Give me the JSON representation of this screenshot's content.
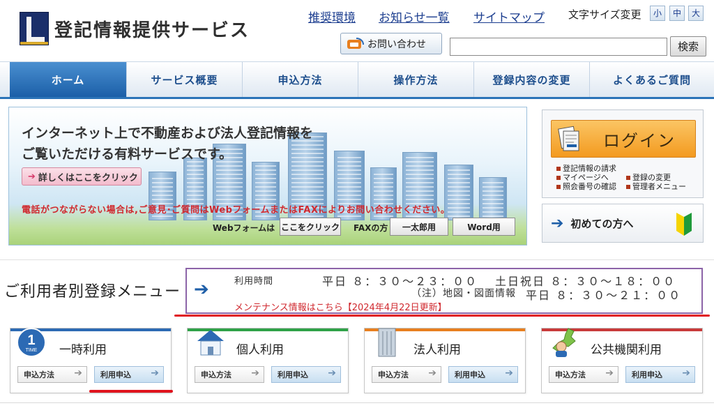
{
  "header": {
    "site_title": "登記情報提供サービス",
    "links": {
      "recommend": "推奨環境",
      "news": "お知らせ一覧",
      "sitemap": "サイトマップ"
    },
    "fontsize_label": "文字サイズ変更",
    "fontsize_options": [
      "小",
      "中",
      "大"
    ],
    "contact_label": "お問い合わせ",
    "search_placeholder": "",
    "search_button": "検索"
  },
  "nav": {
    "items": [
      {
        "label": "ホーム",
        "active": true
      },
      {
        "label": "サービス概要"
      },
      {
        "label": "申込方法"
      },
      {
        "label": "操作方法"
      },
      {
        "label": "登録内容の変更"
      },
      {
        "label": "よくあるご質問"
      }
    ]
  },
  "banner": {
    "title_line1": "インターネット上で不動産および法人登記情報を",
    "title_line2": "ご覧いただける有料サービスです。",
    "detail_button": "詳しくはここをクリック",
    "notice": "電話がつながらない場合は,ご意見･ご質問はWebフォームまたはFAXによりお問い合わせください。",
    "web_label": "Webフォームは",
    "web_button": "ここをクリック",
    "fax_label": "FAXの方",
    "ichitaro_button": "一太郎用",
    "word_button": "Word用"
  },
  "login": {
    "label": "ログイン",
    "sub_items": [
      "登記情報の請求",
      "マイページへ",
      "照会番号の確認",
      "登録の変更",
      "管理者メニュー"
    ],
    "first_time": "初めての方へ"
  },
  "hours": {
    "menu_title": "ご利用者別登録メニュー",
    "label": "利用時間",
    "weekday": "平日 ８：３０～２３：００",
    "weekend": "土日祝日 ８：３０～１８：００",
    "map_note": "（注）地図・図面情報",
    "map_time": "平日 ８：３０～２１：００",
    "maintenance": "メンテナンス情報はこちら【2024年4月22日更新】"
  },
  "cards": [
    {
      "title": "一時利用",
      "icon": "time-1-icon",
      "badge_num": "1",
      "badge_text": "TIME",
      "btn1": "申込方法",
      "btn2": "利用申込"
    },
    {
      "title": "個人利用",
      "icon": "house-icon",
      "btn1": "申込方法",
      "btn2": "利用申込"
    },
    {
      "title": "法人利用",
      "icon": "building-icon",
      "btn1": "申込方法",
      "btn2": "利用申込"
    },
    {
      "title": "公共機関利用",
      "icon": "japan-map-person-icon",
      "btn1": "申込方法",
      "btn2": "利用申込"
    }
  ],
  "colors": {
    "nav_active": "#1b5fa8",
    "login_orange": "#f39a1f",
    "hours_border": "#8c64a8",
    "notice_red": "#d0292f",
    "card_temp": "#2c6ab4",
    "card_personal": "#2fa248",
    "card_corporate": "#e87f1f",
    "card_public": "#c93a3a"
  }
}
